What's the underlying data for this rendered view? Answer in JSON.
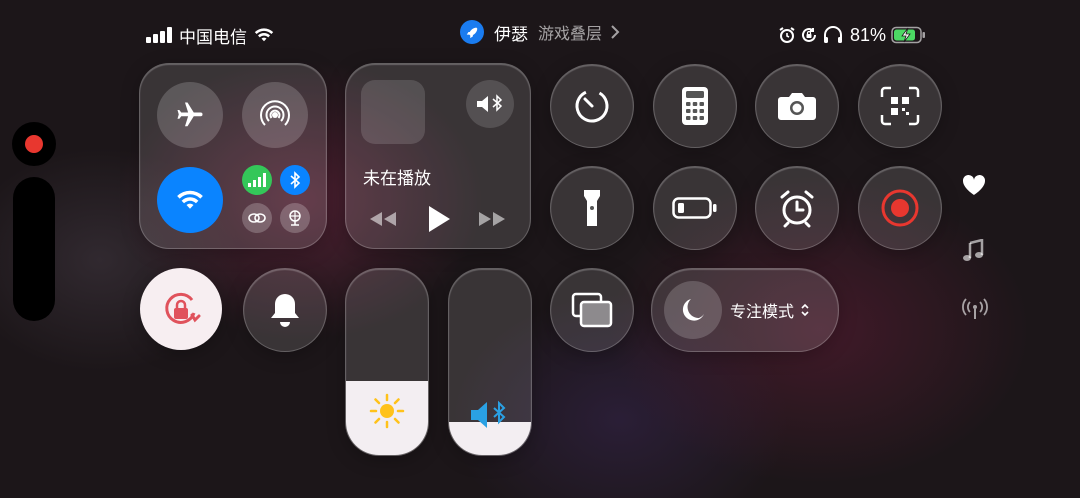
{
  "status_bar": {
    "carrier": "中国电信",
    "app_name": "伊瑟",
    "app_subtitle": "游戏叠层",
    "battery_percent": "81%",
    "icons": [
      "signal-bars-icon",
      "wifi-icon",
      "rocket-icon",
      "chevron-right-icon",
      "alarm-icon",
      "rotation-lock-icon",
      "headphones-icon",
      "battery-charging-icon"
    ]
  },
  "connectivity": {
    "airplane_mode": false,
    "airdrop": false,
    "wifi": true,
    "cellular": true,
    "bluetooth": true,
    "icons": [
      "airplane-icon",
      "airdrop-icon",
      "wifi-icon",
      "cellular-icon",
      "bluetooth-icon",
      "link-icon",
      "globe-icon"
    ]
  },
  "media": {
    "now_playing": "未在播放",
    "icons": [
      "speaker-bluetooth-icon",
      "rewind-icon",
      "play-icon",
      "fast-forward-icon"
    ]
  },
  "focus": {
    "label": "专注模式"
  },
  "brightness_level": 0.4,
  "volume_level": 0.18,
  "colors": {
    "accent_blue": "#0a84ff",
    "cellular_green": "#34c759",
    "record_red": "#e8372f",
    "rotation_lock_red": "#e0525c",
    "sun_yellow": "#ffc21a",
    "battery_green": "#4cd964"
  },
  "controls": [
    "timer-icon",
    "calculator-icon",
    "camera-icon",
    "qr-code-icon",
    "flashlight-icon",
    "low-power-battery-icon",
    "alarm-clock-icon",
    "screen-record-icon",
    "rotation-lock-icon",
    "bell-icon",
    "screen-mirroring-icon",
    "moon-icon"
  ],
  "side_icons": [
    "heart-icon",
    "music-note-icon",
    "antenna-icon"
  ]
}
